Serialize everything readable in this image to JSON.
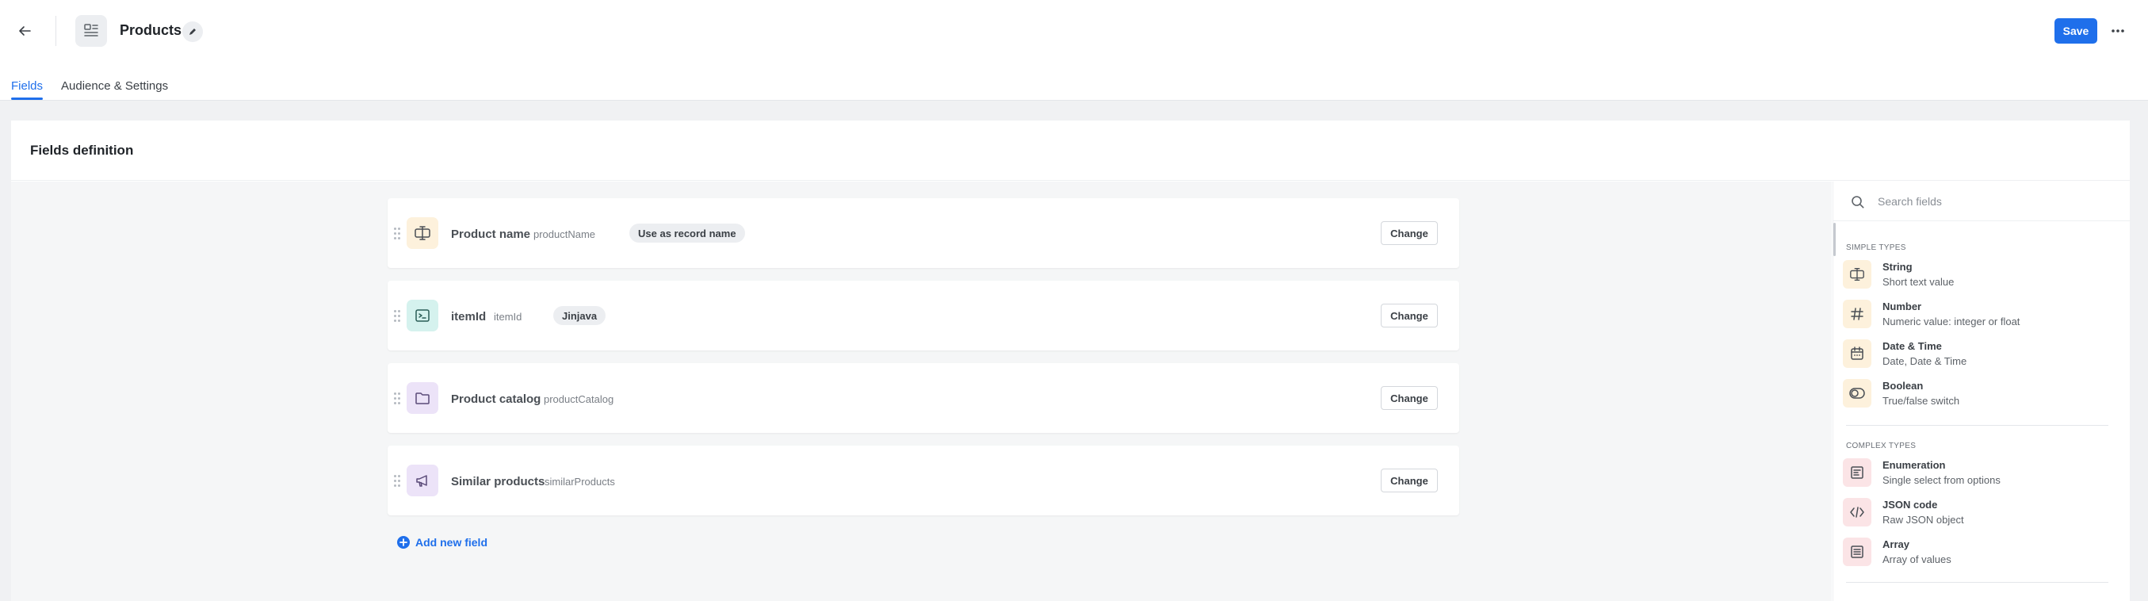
{
  "header": {
    "title": "Products",
    "save_label": "Save"
  },
  "tabs": [
    {
      "label": "Fields",
      "active": true
    },
    {
      "label": "Audience & Settings",
      "active": false
    }
  ],
  "card": {
    "title": "Fields definition"
  },
  "fields": [
    {
      "name": "Product name",
      "key": "productName",
      "tag": "Use as record name",
      "icon": "string-icon",
      "icon_bg": "#fdf1dc",
      "change_label": "Change"
    },
    {
      "name": "itemId",
      "key": "itemId",
      "tag": "Jinjava",
      "icon": "terminal-icon",
      "icon_bg": "#d5f2ee",
      "change_label": "Change"
    },
    {
      "name": "Product catalog",
      "key": "productCatalog",
      "tag": "",
      "icon": "folder-icon",
      "icon_bg": "#ece3f8",
      "change_label": "Change"
    },
    {
      "name": "Similar products",
      "key": "similarProducts",
      "tag": "",
      "icon": "megaphone-icon",
      "icon_bg": "#ece3f8",
      "change_label": "Change"
    }
  ],
  "add_field_label": "Add new field",
  "palette": {
    "search_placeholder": "Search fields",
    "simple_label": "SIMPLE TYPES",
    "simple": [
      {
        "name": "String",
        "desc": "Short text value",
        "icon": "string-icon"
      },
      {
        "name": "Number",
        "desc": "Numeric value: integer or float",
        "icon": "hash-icon"
      },
      {
        "name": "Date & Time",
        "desc": "Date, Date & Time",
        "icon": "calendar-icon"
      },
      {
        "name": "Boolean",
        "desc": "True/false switch",
        "icon": "toggle-icon"
      }
    ],
    "complex_label": "COMPLEX TYPES",
    "complex": [
      {
        "name": "Enumeration",
        "desc": "Single select from options",
        "icon": "enumeration-icon"
      },
      {
        "name": "JSON code",
        "desc": "Raw JSON object",
        "icon": "code-icon"
      },
      {
        "name": "Array",
        "desc": "Array of values",
        "icon": "list-icon"
      }
    ]
  },
  "colors": {
    "accent": "#1f6feb",
    "simple_icon_bg": "#fdf1dc",
    "complex_icon_bg": "#fbe4e6"
  }
}
